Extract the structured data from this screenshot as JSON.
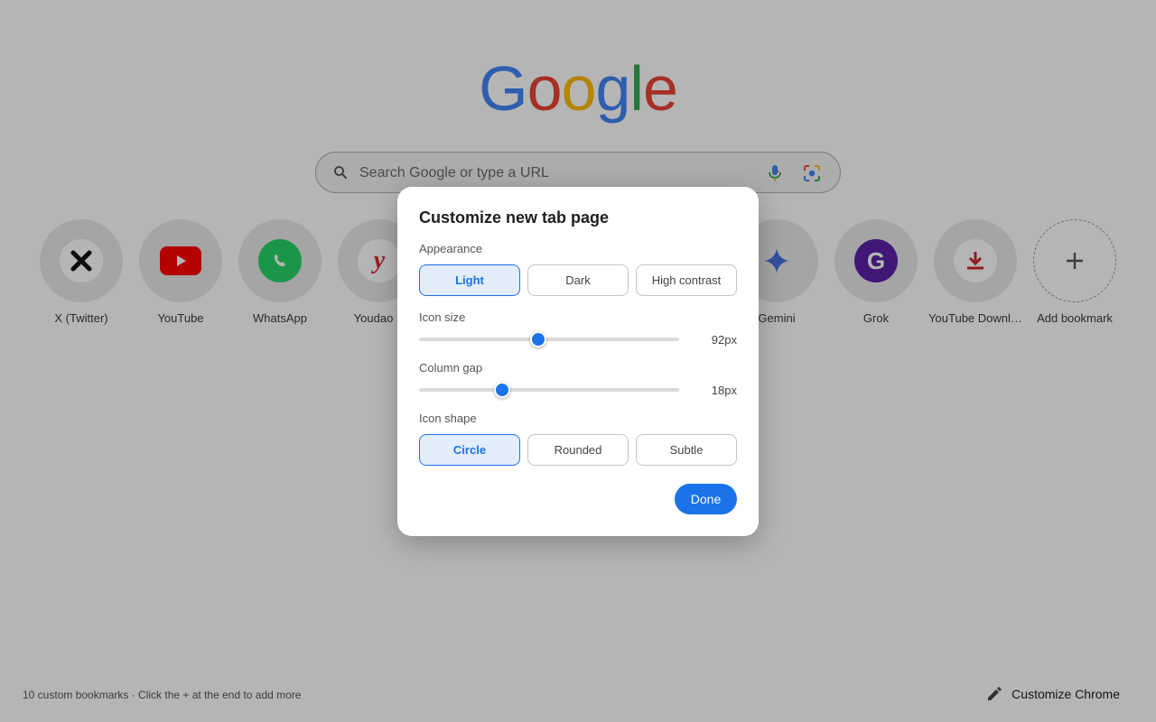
{
  "logo": {
    "letters": [
      {
        "char": "G",
        "color": "#4285f4"
      },
      {
        "char": "o",
        "color": "#ea4335"
      },
      {
        "char": "o",
        "color": "#fbbc05"
      },
      {
        "char": "g",
        "color": "#4285f4"
      },
      {
        "char": "l",
        "color": "#34a853"
      },
      {
        "char": "e",
        "color": "#ea4335"
      }
    ]
  },
  "search": {
    "placeholder": "Search Google or type a URL",
    "search_icon": "search-icon",
    "mic_icon": "microphone-icon",
    "lens_icon": "google-lens-icon"
  },
  "shortcuts": [
    {
      "label": "X (Twitter)",
      "icon": "x-twitter-icon"
    },
    {
      "label": "YouTube",
      "icon": "youtube-icon"
    },
    {
      "label": "WhatsApp",
      "icon": "whatsapp-icon"
    },
    {
      "label": "Youdao D",
      "icon": "youdao-icon"
    },
    {
      "label": "Gemini",
      "icon": "gemini-icon"
    },
    {
      "label": "Grok",
      "icon": "grok-icon"
    },
    {
      "label": "YouTube Downl…",
      "icon": "download-icon"
    },
    {
      "label": "Add bookmark",
      "icon": "plus-icon"
    }
  ],
  "footer": {
    "note": "10 custom bookmarks · Click the + at the end to add more",
    "customize_label": "Customize Chrome",
    "customize_icon": "pencil-icon"
  },
  "dialog": {
    "title": "Customize new tab page",
    "appearance": {
      "label": "Appearance",
      "options": [
        "Light",
        "Dark",
        "High contrast"
      ],
      "selected": "Light"
    },
    "icon_size": {
      "label": "Icon size",
      "value_text": "92px",
      "level": 0.458
    },
    "column_gap": {
      "label": "Column gap",
      "value_text": "18px",
      "level": 0.319
    },
    "icon_shape": {
      "label": "Icon shape",
      "options": [
        "Circle",
        "Rounded",
        "Subtle"
      ],
      "selected": "Circle"
    },
    "done_label": "Done"
  },
  "colors": {
    "accent": "#1a73e8",
    "youtube_red": "#ff0000",
    "whatsapp_green": "#25d366",
    "grok_purple": "#5b21a6",
    "gemini_blue": "#4a6ee0"
  }
}
